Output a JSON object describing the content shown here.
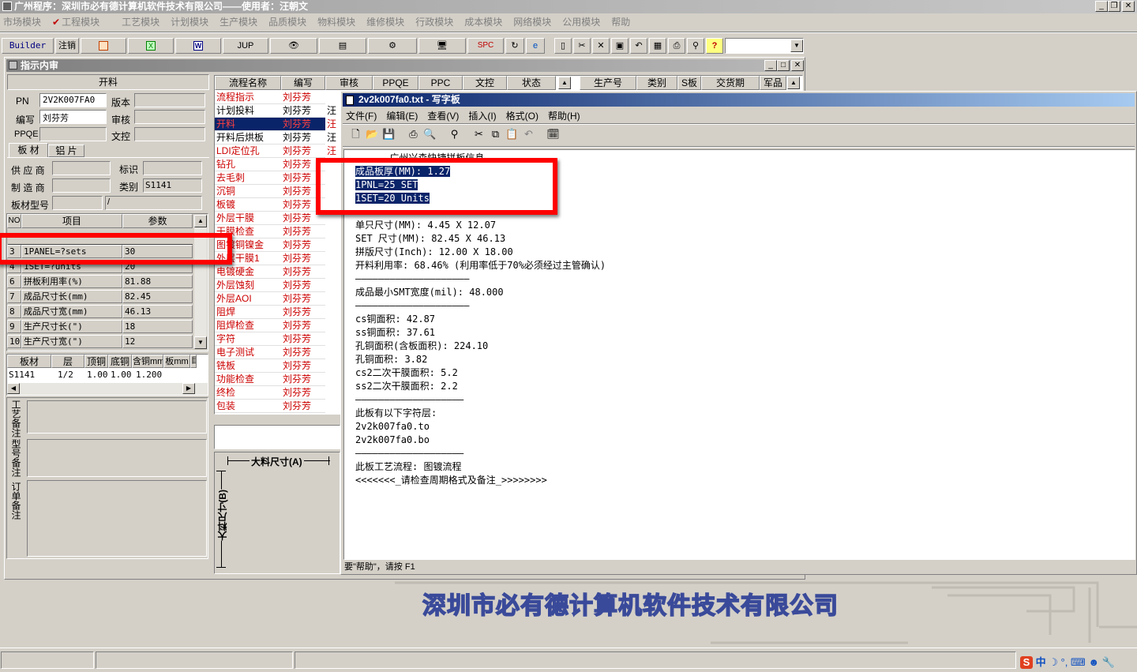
{
  "app": {
    "title": "广州程序：深圳市必有德计算机软件技术有限公司——使用者：汪朝文"
  },
  "menu": [
    {
      "label": "市场模块"
    },
    {
      "label": "工程模块"
    },
    {
      "label": "工艺模块"
    },
    {
      "label": "计划模块"
    },
    {
      "label": "生产模块"
    },
    {
      "label": "品质模块"
    },
    {
      "label": "物料模块"
    },
    {
      "label": "维修模块"
    },
    {
      "label": "行政模块"
    },
    {
      "label": "成本模块"
    },
    {
      "label": "网络模块"
    },
    {
      "label": "公用模块"
    },
    {
      "label": "帮助"
    }
  ],
  "toolbar": {
    "builder": "Builder",
    "logout": "注销",
    "jup": "JUP",
    "spc": "SPC"
  },
  "review": {
    "title": "指示内审",
    "section": "开料",
    "fields": {
      "pn_label": "PN",
      "pn_value": "2V2K007FA0",
      "version_label": "版本",
      "author_label": "编写",
      "author_value": "刘芬芳",
      "audit_label": "审核",
      "ppqe_label": "PPQE",
      "doc_label": "文控"
    },
    "tabs": [
      {
        "label": "板 材"
      },
      {
        "label": "铝 片"
      }
    ],
    "material": {
      "supplier_label": "供 应 商",
      "mark_label": "标识",
      "maker_label": "制 造 商",
      "type_label": "类别",
      "type_value": "S1141",
      "model_label": "板材型号",
      "model_value": "/"
    },
    "params_header": {
      "no": "NO",
      "item": "项目",
      "param": "参数"
    },
    "params": [
      {
        "no": "3",
        "item": "1PANEL=?sets",
        "val": "30"
      },
      {
        "no": "4",
        "item": "1SET=?units",
        "val": "20"
      },
      {
        "no": "6",
        "item": "拼板利用率(%)",
        "val": "81.88"
      },
      {
        "no": "7",
        "item": "成品尺寸长(mm)",
        "val": "82.45"
      },
      {
        "no": "8",
        "item": "成品尺寸宽(mm)",
        "val": "46.13"
      },
      {
        "no": "9",
        "item": "生产尺寸长(\")",
        "val": "18"
      },
      {
        "no": "10",
        "item": "生产尺寸宽(\")",
        "val": "12"
      }
    ],
    "sheet_header": {
      "c1": "板材",
      "c2": "层",
      "c3": "顶铜",
      "c4": "底铜",
      "c5": "含铜mm",
      "c6": "板mm",
      "c7": "目"
    },
    "sheet_row": {
      "c1": "S1141",
      "c2": "1/2",
      "c3": "1.00",
      "c4": "1.00",
      "c5": "1.200"
    },
    "notes": {
      "process": "工艺备注",
      "model": "型号备注",
      "order": "订单备注"
    }
  },
  "flow": {
    "headers": {
      "name": "流程名称",
      "author": "编写",
      "audit": "审核",
      "ppqe": "PPQE",
      "ppc": "PPC",
      "doc": "文控",
      "status": "状态",
      "prod_no": "生产号",
      "category": "类别",
      "s_board": "S板",
      "delivery": "交货期",
      "sample": "军品"
    },
    "rows": [
      {
        "name": "流程指示",
        "author": "刘芬芳",
        "audit": ""
      },
      {
        "name": "计划投料",
        "author": "刘芬芳",
        "audit": "汪"
      },
      {
        "name": "开料",
        "author": "刘芬芳",
        "audit": "汪"
      },
      {
        "name": "开料后烘板",
        "author": "刘芬芳",
        "audit": "汪"
      },
      {
        "name": "LDI定位孔",
        "author": "刘芬芳",
        "audit": "汪"
      },
      {
        "name": "钻孔",
        "author": "刘芬芳",
        "audit": ""
      },
      {
        "name": "去毛刺",
        "author": "刘芬芳",
        "audit": ""
      },
      {
        "name": "沉铜",
        "author": "刘芬芳",
        "audit": ""
      },
      {
        "name": "板镀",
        "author": "刘芬芳",
        "audit": ""
      },
      {
        "name": "外层干膜",
        "author": "刘芬芳",
        "audit": ""
      },
      {
        "name": "干膜检查",
        "author": "刘芬芳",
        "audit": ""
      },
      {
        "name": "图镀铜镍金",
        "author": "刘芬芳",
        "audit": ""
      },
      {
        "name": "外层干膜1",
        "author": "刘芬芳",
        "audit": ""
      },
      {
        "name": "电镀硬金",
        "author": "刘芬芳",
        "audit": ""
      },
      {
        "name": "外层蚀刻",
        "author": "刘芬芳",
        "audit": ""
      },
      {
        "name": "外层AOI",
        "author": "刘芬芳",
        "audit": ""
      },
      {
        "name": "阻焊",
        "author": "刘芬芳",
        "audit": ""
      },
      {
        "name": "阻焊检查",
        "author": "刘芬芳",
        "audit": ""
      },
      {
        "name": "字符",
        "author": "刘芬芳",
        "audit": ""
      },
      {
        "name": "电子测试",
        "author": "刘芬芳",
        "audit": ""
      },
      {
        "name": "铣板",
        "author": "刘芬芳",
        "audit": ""
      },
      {
        "name": "功能检查",
        "author": "刘芬芳",
        "audit": ""
      },
      {
        "name": "终检",
        "author": "刘芬芳",
        "audit": ""
      },
      {
        "name": "包装",
        "author": "刘芬芳",
        "audit": ""
      }
    ],
    "dim_a": "大料尺寸(A)",
    "dim_b": "大料尺寸(B)"
  },
  "wordpad": {
    "title": "2v2k007fa0.txt - 写字板",
    "menu": [
      {
        "label": "文件(F)"
      },
      {
        "label": "编辑(E)"
      },
      {
        "label": "查看(V)"
      },
      {
        "label": "插入(I)"
      },
      {
        "label": "格式(O)"
      },
      {
        "label": "帮助(H)"
      }
    ],
    "lines": [
      "      广州兴森快捷拼板信息",
      "成品板厚(MM): 1.27",
      "1PNL=25 SET",
      "1SET=20 Units",
      "",
      "单只尺寸(MM): 4.45 X 12.07",
      "SET 尺寸(MM): 82.45 X 46.13",
      "拼版尺寸(Inch): 12.00 X 18.00",
      "开料利用率: 68.46% (利用率低于70%必须经过主管确认)",
      "————————————————————",
      "成品最小SMT宽度(mil): 48.000",
      "————————————————————",
      "cs铜面积: 42.87",
      "ss铜面积: 37.61",
      "孔铜面积(含板面积): 224.10",
      "孔铜面积: 3.82",
      "cs2二次干膜面积: 5.2",
      "ss2二次干膜面积: 2.2",
      "———————————————————",
      "此板有以下字符层:",
      "2v2k007fa0.to",
      "2v2k007fa0.bo",
      "———————————————————",
      "此板工艺流程: 图镀流程",
      "<<<<<<<_请检查周期格式及备注_>>>>>>>>"
    ],
    "status": "要\"帮助\"，请按 F1"
  },
  "footer": {
    "company": "深圳市必有德计算机软件技术有限公司",
    "ime": "中"
  },
  "colors": {
    "highlight": "#0a246a",
    "flow_red": "#cc0000",
    "annotation": "#ff0000",
    "company_text": "#3a4a9a"
  }
}
